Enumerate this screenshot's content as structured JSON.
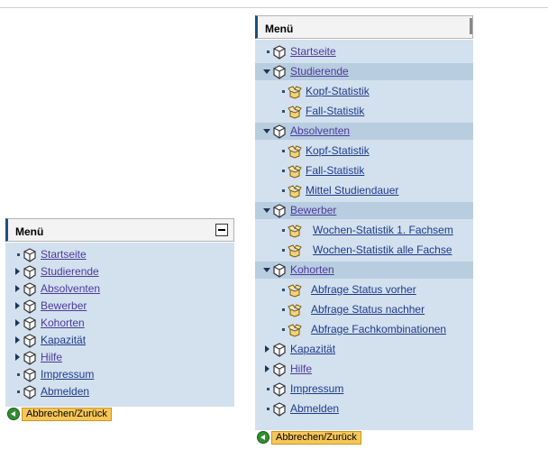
{
  "left_menu": {
    "title": "Menü",
    "items": [
      {
        "label": "Startseite"
      },
      {
        "label": "Studierende"
      },
      {
        "label": "Absolventen"
      },
      {
        "label": "Bewerber"
      },
      {
        "label": "Kohorten"
      },
      {
        "label": "Kapazität"
      },
      {
        "label": "Hilfe"
      },
      {
        "label": "Impressum"
      },
      {
        "label": "Abmelden"
      }
    ],
    "footer_button": "Abbrechen/Zurück"
  },
  "right_menu": {
    "title": "Menü",
    "items": [
      {
        "label": "Startseite"
      },
      {
        "label": "Studierende"
      },
      {
        "label": "Kopf-Statistik"
      },
      {
        "label": "Fall-Statistik"
      },
      {
        "label": "Absolventen"
      },
      {
        "label": "Kopf-Statistik"
      },
      {
        "label": "Fall-Statistik"
      },
      {
        "label": "Mittel Studiendauer"
      },
      {
        "label": "Bewerber"
      },
      {
        "label": "Wochen-Statistik 1. Fachsem"
      },
      {
        "label": "Wochen-Statistik alle Fachse"
      },
      {
        "label": "Kohorten"
      },
      {
        "label": "Abfrage Status vorher"
      },
      {
        "label": "Abfrage Status nachher"
      },
      {
        "label": "Abfrage Fachkombinationen"
      },
      {
        "label": "Kapazität"
      },
      {
        "label": "Hilfe"
      },
      {
        "label": "Impressum"
      },
      {
        "label": "Abmelden"
      }
    ],
    "footer_button": "Abbrechen/Zurück"
  },
  "icons": {
    "top_level": "package-icon",
    "sub_level": "open-package-icon",
    "back": "back-arrow-icon"
  }
}
